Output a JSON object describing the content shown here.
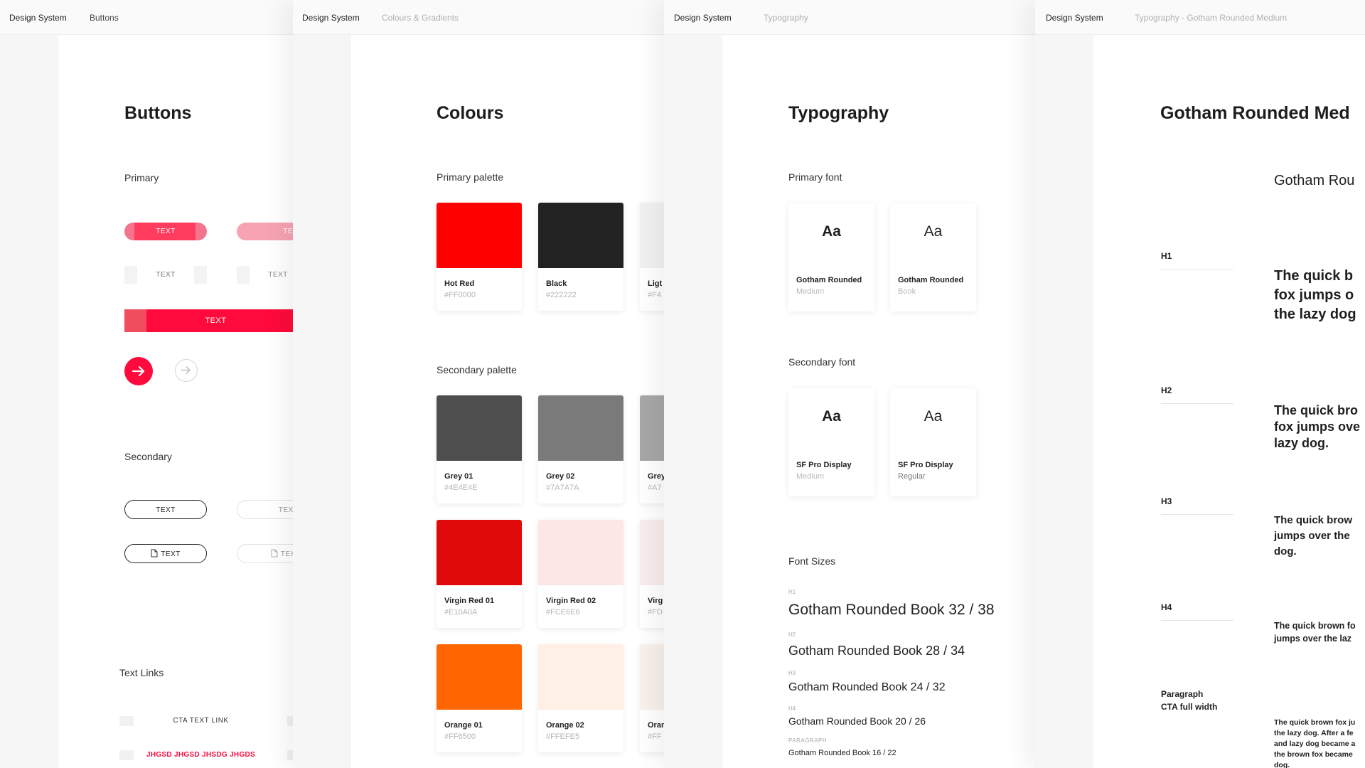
{
  "panels": {
    "buttons": {
      "breadcrumb_root": "Design System",
      "breadcrumb_page": "Buttons",
      "title": "Buttons",
      "primary_label": "Primary",
      "secondary_label": "Secondary",
      "text_links_label": "Text Links",
      "button_text": "TEXT",
      "cta_text_link": "CTA TEXT LINK",
      "red_text_link": "JHGSD JHGSD JHSDG JHGDS"
    },
    "colours": {
      "breadcrumb_root": "Design System",
      "breadcrumb_page": "Colours & Gradients",
      "title": "Colours",
      "primary_label": "Primary palette",
      "secondary_label": "Secondary palette",
      "primary_swatches": [
        {
          "name": "Hot Red",
          "hex": "#FF0000",
          "color": "#FF0000"
        },
        {
          "name": "Black",
          "hex": "#222222",
          "color": "#222222"
        },
        {
          "name": "Ligt",
          "hex": "#F4",
          "color": "#F4F4F4"
        }
      ],
      "secondary_swatches": [
        {
          "name": "Grey 01",
          "hex": "#4E4E4E",
          "color": "#4E4E4E"
        },
        {
          "name": "Grey 02",
          "hex": "#7A7A7A",
          "color": "#7A7A7A"
        },
        {
          "name": "Grey",
          "hex": "#A7",
          "color": "#A7A7A7"
        },
        {
          "name": "Virgin Red 01",
          "hex": "#E10A0A",
          "color": "#E10A0A"
        },
        {
          "name": "Virgin Red 02",
          "hex": "#FCE6E6",
          "color": "#FCE6E6"
        },
        {
          "name": "Virg",
          "hex": "#FD",
          "color": "#FDF0F0"
        },
        {
          "name": "Orange 01",
          "hex": "#FF6500",
          "color": "#FF6500"
        },
        {
          "name": "Orange 02",
          "hex": "#FFEFE5",
          "color": "#FFEFE5"
        },
        {
          "name": "Oran",
          "hex": "#FF",
          "color": "#FFF6F0"
        }
      ]
    },
    "typography": {
      "breadcrumb_root": "Design System",
      "breadcrumb_page": "Typography",
      "title": "Typography",
      "primary_label": "Primary font",
      "secondary_label": "Secondary font",
      "aa": "Aa",
      "primary_fonts": [
        {
          "name": "Gotham Rounded",
          "style": "Medium"
        },
        {
          "name": "Gotham Rounded",
          "style": "Book"
        }
      ],
      "secondary_fonts": [
        {
          "name": "SF Pro Display",
          "style": "Medium"
        },
        {
          "name": "SF Pro Display",
          "style": "Regular"
        }
      ],
      "font_sizes_label": "Font Sizes",
      "sizes": [
        {
          "tag": "H1",
          "sample": "Gotham Rounded Book 32 / 38"
        },
        {
          "tag": "H2",
          "sample": "Gotham Rounded Book 28 / 34"
        },
        {
          "tag": "H3",
          "sample": "Gotham Rounded Book 24 / 32"
        },
        {
          "tag": "H4",
          "sample": "Gotham Rounded Book 20 / 26"
        },
        {
          "tag": "PARAGRAPH",
          "sample": "Gotham Rounded Book 16 / 22"
        }
      ]
    },
    "gotham": {
      "breadcrumb_root": "Design System",
      "breadcrumb_page": "Typography - Gotham Rounded Medium",
      "title": "Gotham Rounded Med",
      "subtitle": "Gotham Rou",
      "rows": [
        {
          "label": "H1",
          "sample_lines": [
            "The quick b",
            "fox jumps o",
            "the lazy dog"
          ]
        },
        {
          "label": "H2",
          "sample_lines": [
            "The quick bro",
            "fox jumps ove",
            "lazy dog."
          ]
        },
        {
          "label": "H3",
          "sample_lines": [
            "The quick brow",
            "jumps over the",
            "dog."
          ]
        },
        {
          "label": "H4",
          "sample_lines": [
            "The quick brown fo",
            "jumps over the laz"
          ]
        }
      ],
      "paragraph_label_1": "Paragraph",
      "paragraph_label_2": "CTA full width",
      "paragraph_lines": [
        "The quick brown fox ju",
        "the lazy dog. After a fe",
        "and lazy dog became a",
        "the brown fox became",
        "dog."
      ]
    }
  },
  "colors": {
    "accent_red": "#FF0A3C",
    "accent_pink": "#F4738D"
  }
}
